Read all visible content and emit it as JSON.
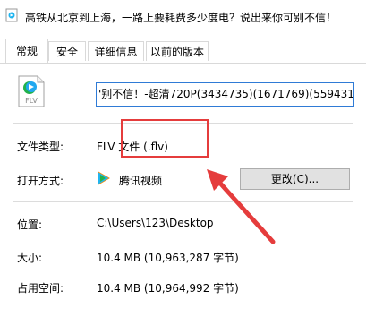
{
  "window": {
    "title": "高铁从北京到上海，一路上要耗费多少度电？说出来你可别不信！"
  },
  "tabs": [
    {
      "label": "常规"
    },
    {
      "label": "安全"
    },
    {
      "label": "详细信息"
    },
    {
      "label": "以前的版本"
    }
  ],
  "file": {
    "name": "'别不信！-超清720P(3434735)(1671769)(5594314)",
    "icon": "flv-file-icon",
    "icon_text": "FLV"
  },
  "properties": {
    "type_label": "文件类型:",
    "type_value": "FLV 文件 (.flv)",
    "open_with_label": "打开方式:",
    "open_with_value": "腾讯视频",
    "change_button": "更改(C)...",
    "location_label": "位置:",
    "location_value": "C:\\Users\\123\\Desktop",
    "size_label": "大小:",
    "size_value": "10.4 MB (10,963,287 字节)",
    "disk_size_label": "占用空间:",
    "disk_size_value": "10.4 MB (10,964,992 字节)"
  },
  "colors": {
    "annotation": "#e53c3c",
    "input_border": "#2f7bd6"
  }
}
